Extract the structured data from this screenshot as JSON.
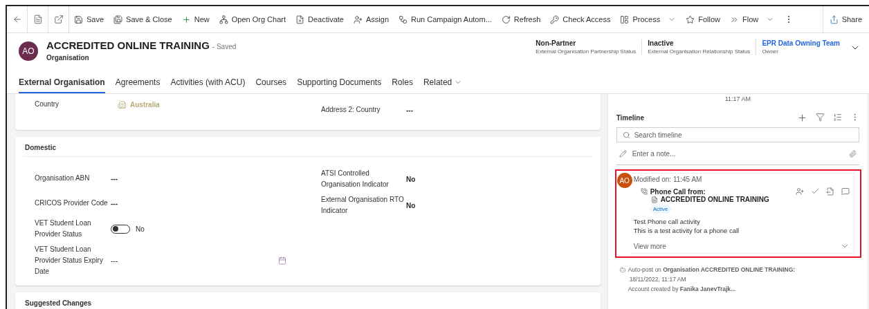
{
  "toolbar": {
    "items": [
      {
        "label": "Save",
        "chevron": false
      },
      {
        "label": "Save & Close",
        "chevron": false
      },
      {
        "label": "New",
        "chevron": false
      },
      {
        "label": "Open Org Chart",
        "chevron": false
      },
      {
        "label": "Deactivate",
        "chevron": false
      },
      {
        "label": "Assign",
        "chevron": false
      },
      {
        "label": "Run Campaign Autom...",
        "chevron": false
      },
      {
        "label": "Refresh",
        "chevron": false
      },
      {
        "label": "Check Access",
        "chevron": false
      },
      {
        "label": "Process",
        "chevron": true
      },
      {
        "label": "Follow",
        "chevron": false
      },
      {
        "label": "Flow",
        "chevron": true
      }
    ],
    "share": "Share"
  },
  "record": {
    "initials": "AO",
    "title": "ACCREDITED ONLINE TRAINING",
    "save_state": "- Saved",
    "entity": "Organisation",
    "header_fields": [
      {
        "value": "Non-Partner",
        "label": "External Organisation Partnership Status",
        "kind": "text"
      },
      {
        "value": "Inactive",
        "label": "External Organisation Relationship Status",
        "kind": "text"
      },
      {
        "value": "EPR Data Owning Team",
        "label": "Owner",
        "kind": "link"
      }
    ]
  },
  "tabs": [
    {
      "label": "External Organisation",
      "selected": true,
      "chevron": false
    },
    {
      "label": "Agreements",
      "selected": false,
      "chevron": false
    },
    {
      "label": "Activities (with ACU)",
      "selected": false,
      "chevron": false
    },
    {
      "label": "Courses",
      "selected": false,
      "chevron": false
    },
    {
      "label": "Supporting Documents",
      "selected": false,
      "chevron": false
    },
    {
      "label": "Roles",
      "selected": false,
      "chevron": false
    },
    {
      "label": "Related",
      "selected": false,
      "chevron": true
    }
  ],
  "address_section": {
    "left": [
      {
        "label": "Country",
        "value": "Australia",
        "kind": "lookup"
      }
    ],
    "right": [
      {
        "label": "Address 2: Country",
        "value": "---",
        "kind": "text"
      }
    ]
  },
  "domestic_section": {
    "title": "Domestic",
    "left": [
      {
        "label": "Organisation ABN",
        "value": "---",
        "kind": "text"
      },
      {
        "label": "CRICOS Provider Code",
        "value": "---",
        "kind": "text"
      },
      {
        "label": "VET Student Loan Provider Status",
        "value": "No",
        "kind": "toggle",
        "on": false
      },
      {
        "label": "VET Student Loan Provider Status Expiry Date",
        "value": "---",
        "kind": "date"
      }
    ],
    "right": [
      {
        "label": "ATSI Controlled Organisation Indicator",
        "value": "No",
        "kind": "text"
      },
      {
        "label": "External Organisation RTO Indicator",
        "value": "No",
        "kind": "text"
      }
    ]
  },
  "suggested_section": {
    "title": "Suggested Changes"
  },
  "timeline": {
    "previous_time": "11:17 AM",
    "title": "Timeline",
    "search_placeholder": "Search timeline",
    "note_placeholder": "Enter a note...",
    "activity": {
      "initials": "AO",
      "modified": "Modified on: 11:45 AM",
      "heading": "Phone Call from:",
      "regarding": "ACCREDITED ONLINE TRAINING",
      "status": "Active",
      "subject": "Test Phone call activity",
      "description": "This is a test activity for a phone call",
      "view_more": "View more"
    },
    "post": {
      "text": "Auto-post on **Organisation ACCREDITED ONLINE TRAINING:**",
      "date": "18/11/2022, 11:17 AM",
      "body": "Account created by **Fanika JanevTrajk...**"
    }
  }
}
